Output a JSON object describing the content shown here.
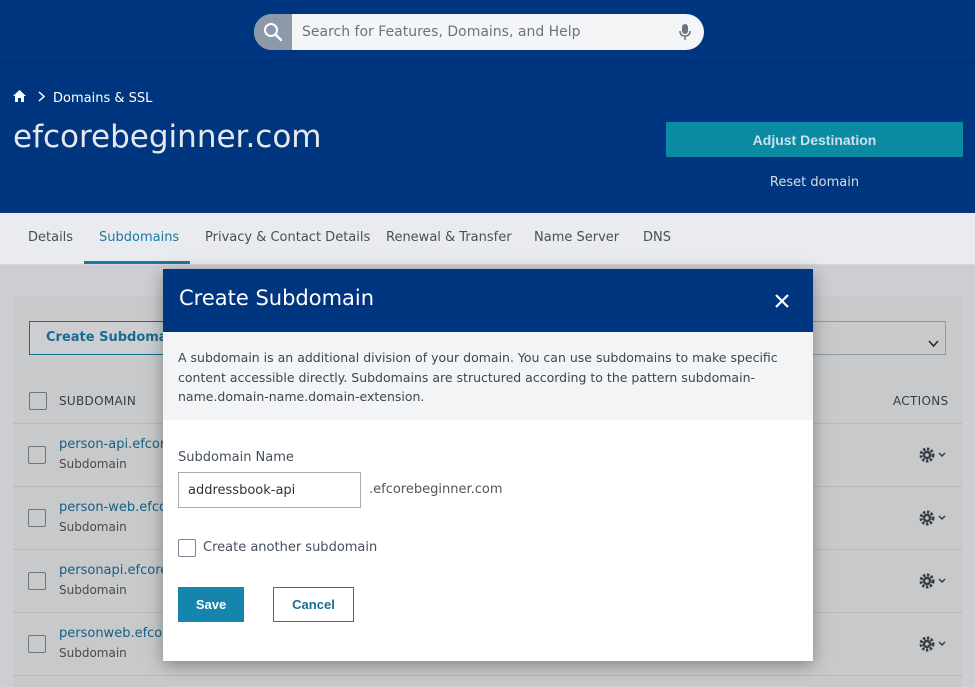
{
  "search": {
    "placeholder": "Search for Features, Domains, and Help"
  },
  "breadcrumb": {
    "section": "Domains & SSL"
  },
  "header": {
    "domain": "efcorebeginner.com",
    "adjust_label": "Adjust Destination",
    "reset_label": "Reset domain"
  },
  "tabs": [
    {
      "label": "Details"
    },
    {
      "label": "Subdomains",
      "active": true
    },
    {
      "label": "Privacy & Contact Details"
    },
    {
      "label": "Renewal & Transfer"
    },
    {
      "label": "Name Server"
    },
    {
      "label": "DNS"
    }
  ],
  "table": {
    "create_button": "Create Subdomain",
    "col_subdomain": "SUBDOMAIN",
    "col_actions": "ACTIONS",
    "rows": [
      {
        "name": "person-api.efcore",
        "type": "Subdomain"
      },
      {
        "name": "person-web.efcor",
        "type": "Subdomain"
      },
      {
        "name": "personapi.efcore",
        "type": "Subdomain"
      },
      {
        "name": "personweb.efcor",
        "type": "Subdomain"
      }
    ]
  },
  "modal": {
    "title": "Create Subdomain",
    "description": "A subdomain is an additional division of your domain. You can use subdomains to make specific content accessible directly. Subdomains are structured according to the pattern subdomain-name.domain-name.domain-extension.",
    "field_label": "Subdomain Name",
    "field_value": "addressbook-api",
    "suffix": ".efcorebeginner.com",
    "another_label": "Create another subdomain",
    "save_label": "Save",
    "cancel_label": "Cancel"
  },
  "colors": {
    "brand_navy": "#003680",
    "accent_teal": "#0a8ba3",
    "link_blue": "#1b7aa3"
  }
}
